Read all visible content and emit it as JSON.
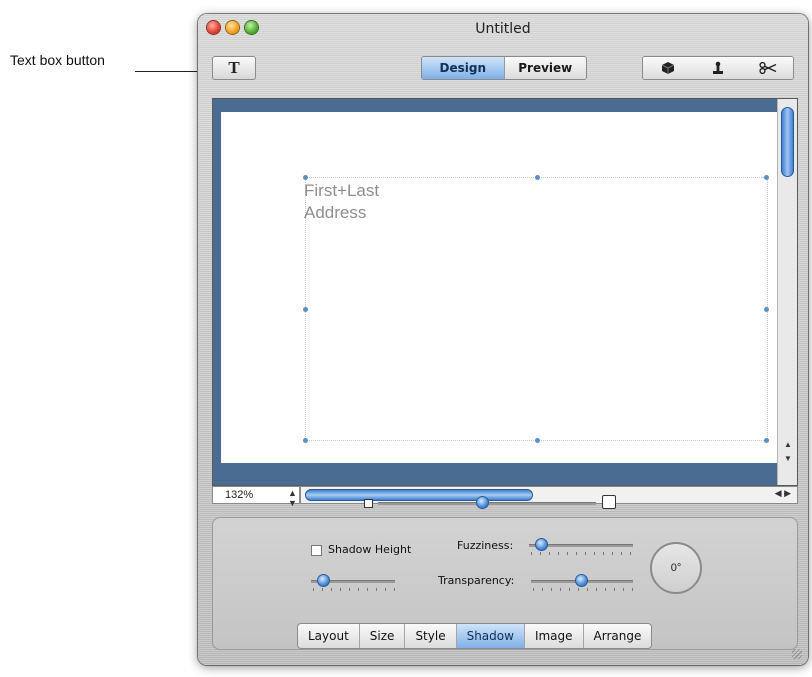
{
  "annotation": {
    "label": "Text box button"
  },
  "window": {
    "title": "Untitled"
  },
  "toolbar": {
    "text_button_label": "T",
    "mode_tabs": [
      {
        "label": "Design",
        "active": true
      },
      {
        "label": "Preview",
        "active": false
      }
    ],
    "tool_icons": [
      "cube-icon",
      "stamp-icon",
      "scissors-icon"
    ]
  },
  "canvas": {
    "text_lines": [
      "First+Last",
      "Address"
    ]
  },
  "zoom": {
    "value": "132%"
  },
  "inspector": {
    "shadow_height_label": "Shadow Height",
    "fuzziness_label": "Fuzziness:",
    "transparency_label": "Transparency:",
    "angle_value": "0°",
    "tabs": [
      {
        "label": "Layout",
        "active": false
      },
      {
        "label": "Size",
        "active": false
      },
      {
        "label": "Style",
        "active": false
      },
      {
        "label": "Shadow",
        "active": true
      },
      {
        "label": "Image",
        "active": false
      },
      {
        "label": "Arrange",
        "active": false
      }
    ]
  },
  "colors": {
    "accent": "#7fb0e6",
    "canvas_border": "#4a6b92"
  }
}
